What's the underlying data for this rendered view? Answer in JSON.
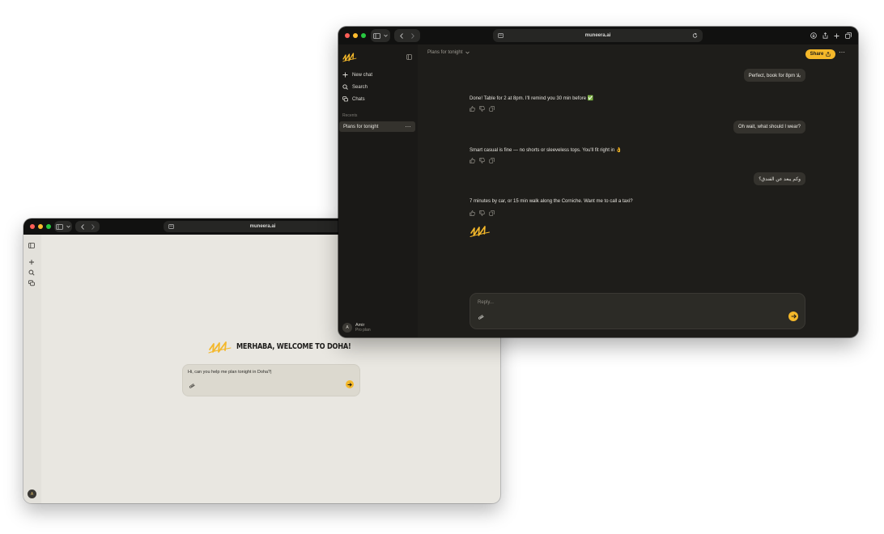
{
  "colors": {
    "accent": "#f4b82a",
    "dark_bg": "#1e1d1a",
    "light_bg": "#e9e7e1"
  },
  "light_window": {
    "url": "muneera.ai",
    "welcome": "MERHABA, WELCOME TO DOHA!",
    "input_text": "Hi, can you help me plan tonight in Doha?|",
    "avatar_initial": "A"
  },
  "dark_window": {
    "url": "muneera.ai",
    "sidebar": {
      "items": [
        {
          "label": "New chat",
          "icon": "plus-icon"
        },
        {
          "label": "Search",
          "icon": "search-icon"
        },
        {
          "label": "Chats",
          "icon": "chats-icon"
        }
      ],
      "recents_label": "Recents",
      "recent_chat": "Plans for tonight",
      "user_name": "Amir",
      "user_plan": "Pro plan",
      "avatar_initial": "A"
    },
    "header": {
      "chat_title": "Plans for tonight",
      "share_label": "Share"
    },
    "messages": [
      {
        "role": "user",
        "text": "Perfect, book for 8pm يلا"
      },
      {
        "role": "assistant",
        "text": "Done! Table for 2 at 8pm. I'll remind you 30 min before ✅"
      },
      {
        "role": "user",
        "text": "Oh wait, what should I wear?"
      },
      {
        "role": "assistant",
        "text": "Smart casual is fine — no shorts or sleeveless tops. You'll fit right in 👌"
      },
      {
        "role": "user",
        "text": "وكم يبعد عن الفندق؟"
      },
      {
        "role": "assistant",
        "text": "7 minutes by car, or 15 min walk along the Corniche. Want me to call a taxi?"
      }
    ],
    "reply_placeholder": "Reply..."
  }
}
